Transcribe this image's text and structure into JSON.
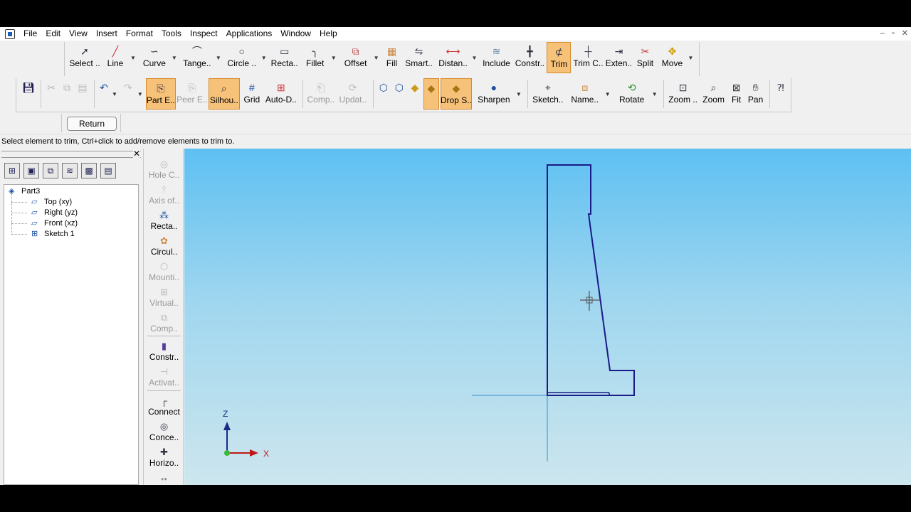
{
  "menu": [
    "File",
    "Edit",
    "View",
    "Insert",
    "Format",
    "Tools",
    "Inspect",
    "Applications",
    "Window",
    "Help"
  ],
  "window_controls": [
    "–",
    "▫",
    "✕"
  ],
  "ribbon_top": [
    {
      "label": "Select ..",
      "icon": "cursor-icon"
    },
    {
      "label": "Line",
      "icon": "line-icon"
    },
    {
      "label": "Curve",
      "icon": "curve-icon"
    },
    {
      "label": "Tange..",
      "icon": "tangent-arc-icon"
    },
    {
      "label": "Circle ..",
      "icon": "circle-icon"
    },
    {
      "label": "Recta..",
      "icon": "rectangle-icon"
    },
    {
      "label": "Fillet",
      "icon": "fillet-icon"
    },
    {
      "label": "Offset",
      "icon": "offset-icon"
    },
    {
      "label": "Fill",
      "icon": "fill-icon"
    },
    {
      "label": "Smart..",
      "icon": "smart-dimension-icon"
    },
    {
      "label": "Distan..",
      "icon": "distance-icon"
    },
    {
      "label": "Include",
      "icon": "include-icon"
    },
    {
      "label": "Constr..",
      "icon": "construction-icon"
    },
    {
      "label": "Trim",
      "icon": "trim-icon",
      "active": true
    },
    {
      "label": "Trim C..",
      "icon": "trim-corner-icon"
    },
    {
      "label": "Exten..",
      "icon": "extend-icon"
    },
    {
      "label": "Split",
      "icon": "split-icon"
    },
    {
      "label": "Move",
      "icon": "move-icon"
    }
  ],
  "ribbon_bottom": [
    {
      "label": "Part E..",
      "icon": "part-environment-icon",
      "active": true
    },
    {
      "label": "Peer E..",
      "icon": "peer-environment-icon",
      "disabled": true
    },
    {
      "label": "Silhou..",
      "icon": "silhouette-icon",
      "active": true
    },
    {
      "label": "Grid",
      "icon": "grid-icon"
    },
    {
      "label": "Auto-D..",
      "icon": "auto-dimension-icon"
    },
    {
      "label": "Comp..",
      "icon": "compare-icon",
      "disabled": true
    },
    {
      "label": "Updat..",
      "icon": "update-icon",
      "disabled": true
    },
    {
      "label": "Drop S..",
      "icon": "drop-shadow-icon",
      "active": true
    },
    {
      "label": "Sharpen",
      "icon": "sharpen-icon"
    },
    {
      "label": "Sketch..",
      "icon": "sketch-view-icon"
    },
    {
      "label": "Name..",
      "icon": "named-view-icon"
    },
    {
      "label": "Rotate",
      "icon": "rotate-icon"
    },
    {
      "label": "Zoom ..",
      "icon": "zoom-area-icon"
    },
    {
      "label": "Zoom",
      "icon": "zoom-icon"
    },
    {
      "label": "Fit",
      "icon": "fit-icon"
    },
    {
      "label": "Pan",
      "icon": "pan-icon"
    }
  ],
  "return_label": "Return",
  "status_text": "Select element to trim, Ctrl+click to add/remove elements to trim to.",
  "tree": {
    "root": "Part3",
    "children": [
      "Top (xy)",
      "Right (yz)",
      "Front (xz)",
      "Sketch 1"
    ]
  },
  "vertical_commands": [
    {
      "label": "Hole C..",
      "icon": "hole-circle-icon",
      "disabled": true
    },
    {
      "label": "Axis of..",
      "icon": "axis-of-symmetry-icon",
      "disabled": true
    },
    {
      "label": "Recta..",
      "icon": "rectangular-pattern-icon"
    },
    {
      "label": "Circul..",
      "icon": "circular-pattern-icon"
    },
    {
      "label": "Mounti..",
      "icon": "mounting-boss-icon",
      "disabled": true
    },
    {
      "label": "Virtual..",
      "icon": "virtual-sharp-icon",
      "disabled": true
    },
    {
      "label": "Comp..",
      "icon": "component-icon",
      "disabled": true
    },
    {
      "label": "Constr..",
      "icon": "construction-icon"
    },
    {
      "label": "Activat..",
      "icon": "activate-icon",
      "disabled": true
    },
    {
      "label": "Connect",
      "icon": "connect-icon"
    },
    {
      "label": "Conce..",
      "icon": "concentric-icon"
    },
    {
      "label": "Horizo..",
      "icon": "horizontal-vertical-icon"
    }
  ],
  "axes": {
    "z_label": "Z",
    "x_label": "X"
  },
  "colors": {
    "active_bg": "#f6c27a",
    "sketch_line": "#1a1a88",
    "viewport_top": "#5ec0f2",
    "viewport_bottom": "#cde6ee"
  }
}
